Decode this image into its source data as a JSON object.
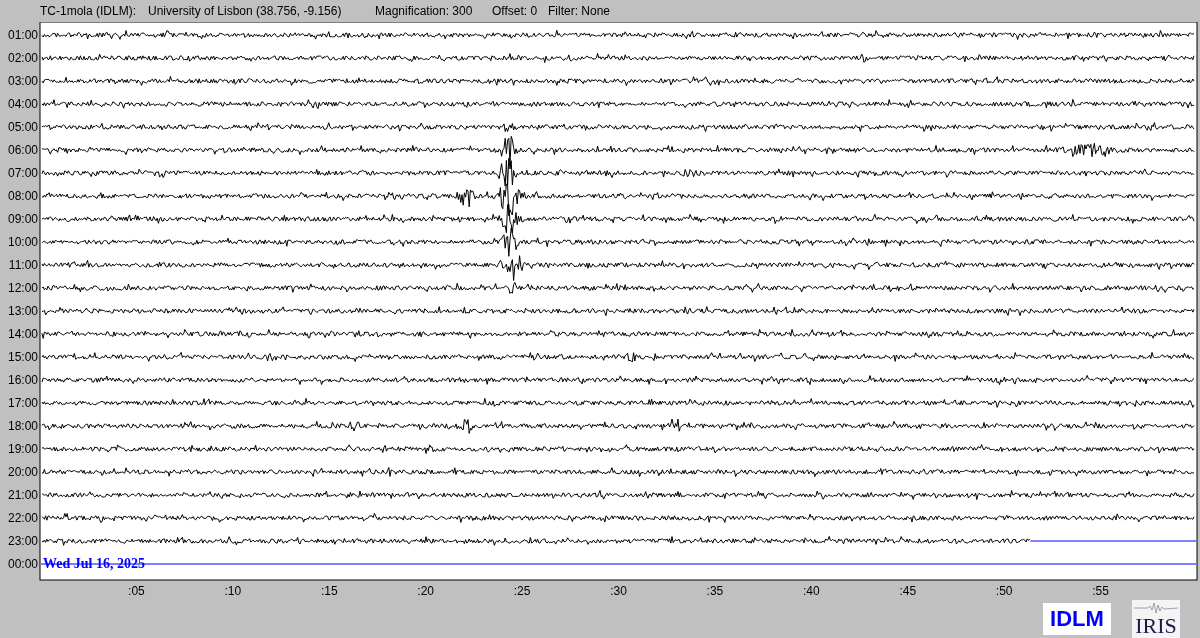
{
  "header": {
    "station": "TC-1mola (IDLM):",
    "location": "University of Lisbon (38.756, -9.156)",
    "magnification": "Magnification: 300",
    "offset": "Offset: 0",
    "filter": "Filter: None"
  },
  "rows": [
    {
      "time": "01:00",
      "kind": "full"
    },
    {
      "time": "02:00",
      "kind": "full"
    },
    {
      "time": "03:00",
      "kind": "full"
    },
    {
      "time": "04:00",
      "kind": "full"
    },
    {
      "time": "05:00",
      "kind": "full"
    },
    {
      "time": "06:00",
      "kind": "full"
    },
    {
      "time": "07:00",
      "kind": "full"
    },
    {
      "time": "08:00",
      "kind": "full"
    },
    {
      "time": "09:00",
      "kind": "full"
    },
    {
      "time": "10:00",
      "kind": "full"
    },
    {
      "time": "11:00",
      "kind": "full"
    },
    {
      "time": "12:00",
      "kind": "full"
    },
    {
      "time": "13:00",
      "kind": "full"
    },
    {
      "time": "14:00",
      "kind": "full"
    },
    {
      "time": "15:00",
      "kind": "full"
    },
    {
      "time": "16:00",
      "kind": "full"
    },
    {
      "time": "17:00",
      "kind": "full"
    },
    {
      "time": "18:00",
      "kind": "full"
    },
    {
      "time": "19:00",
      "kind": "full"
    },
    {
      "time": "20:00",
      "kind": "full"
    },
    {
      "time": "21:00",
      "kind": "full"
    },
    {
      "time": "22:00",
      "kind": "full"
    },
    {
      "time": "23:00",
      "kind": "partial",
      "level": 0.856
    },
    {
      "time": "00:00",
      "kind": "current"
    }
  ],
  "date": "Wed Jul 16, 2025",
  "minute_ticks": [
    ":05",
    ":10",
    ":15",
    ":20",
    ":25",
    ":30",
    ":35",
    ":40",
    ":45",
    ":50",
    ":55"
  ],
  "logos": {
    "network": "IDLM",
    "consortium": "IRIS"
  }
}
